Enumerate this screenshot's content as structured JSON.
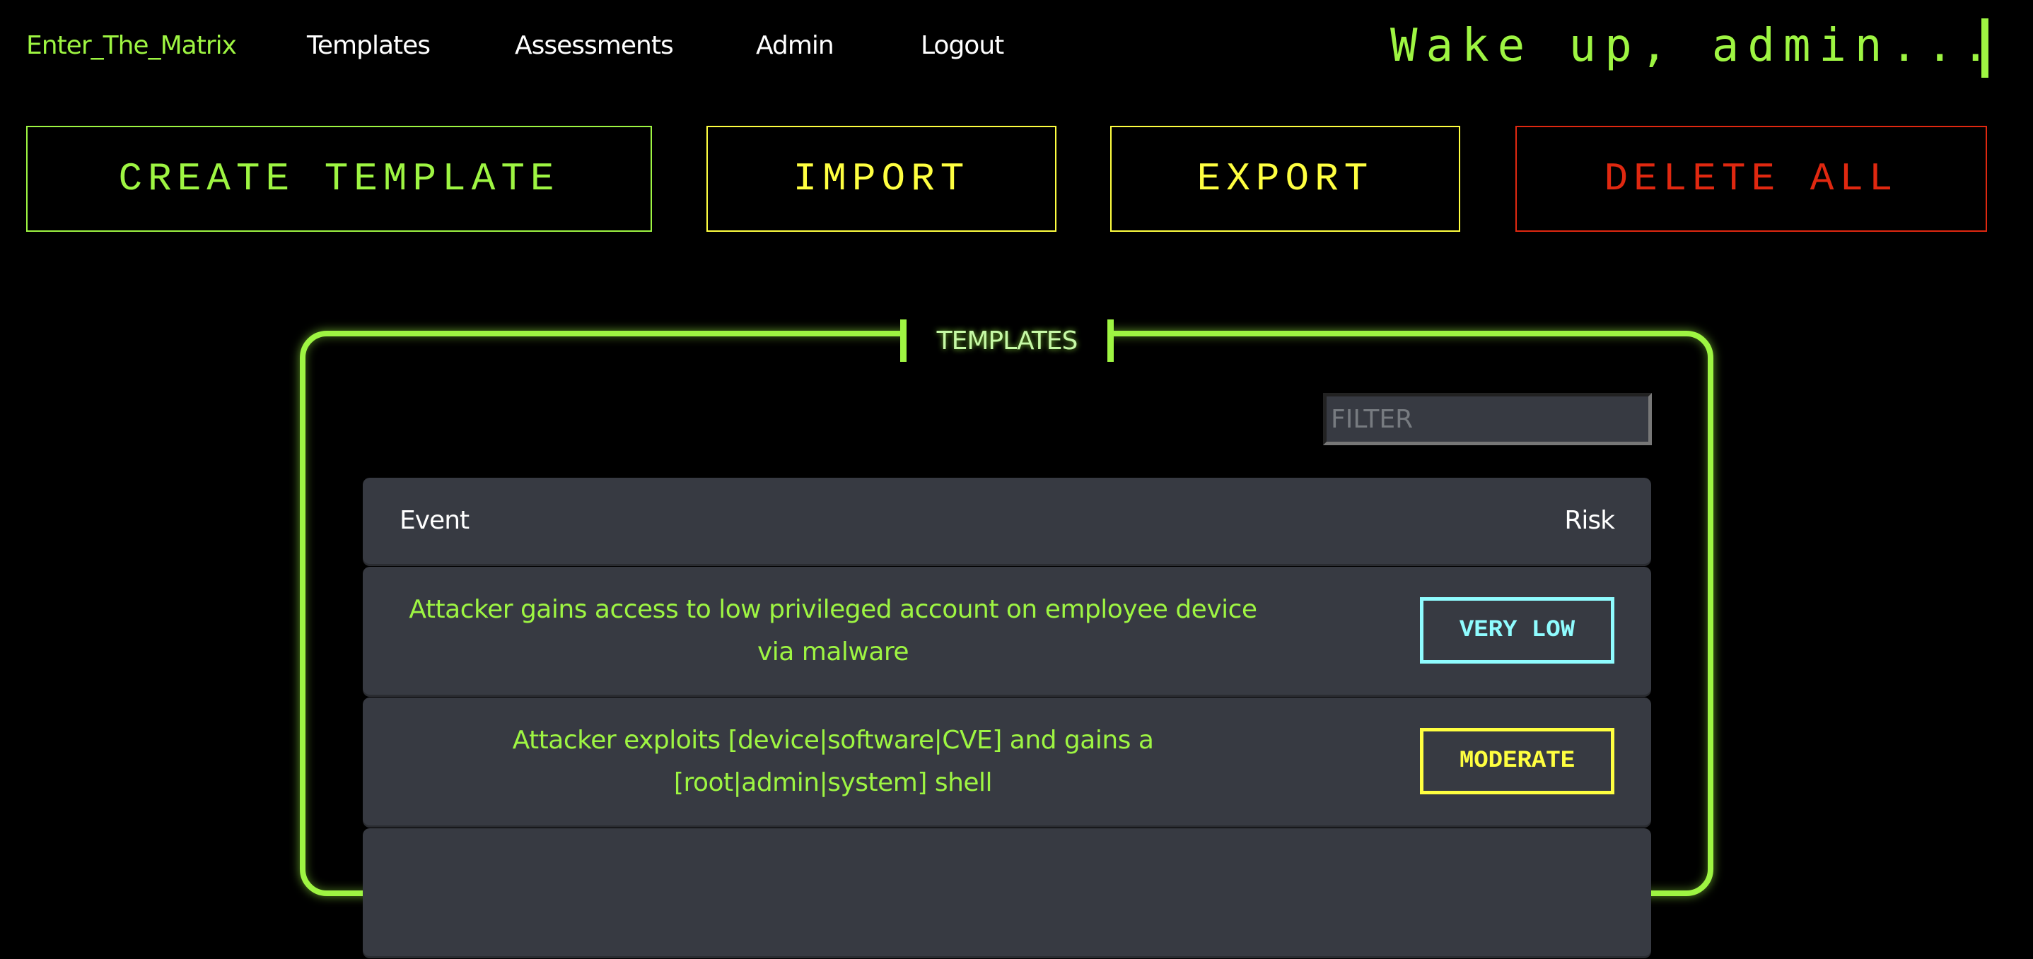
{
  "nav": {
    "brand": "Enter_The_Matrix",
    "items": [
      "Templates",
      "Assessments",
      "Admin",
      "Logout"
    ],
    "greeting": "Wake up, admin..."
  },
  "actions": {
    "create": "CREATE TEMPLATE",
    "import": "IMPORT",
    "export": "EXPORT",
    "delete_all": "DELETE ALL"
  },
  "panel": {
    "title": "TEMPLATES",
    "filter_placeholder": "FILTER",
    "filter_value": "",
    "columns": {
      "event": "Event",
      "risk": "Risk"
    },
    "rows": [
      {
        "event": "Attacker gains access to low privileged account on employee device via malware",
        "risk": "VERY LOW",
        "risk_color": "#8ffcff"
      },
      {
        "event": "Attacker exploits [device|software|CVE] and gains a [root|admin|system] shell",
        "risk": "MODERATE",
        "risk_color": "#ffff40"
      },
      {
        "event": "",
        "risk": "",
        "risk_color": ""
      }
    ]
  },
  "colors": {
    "accent": "#9ef542",
    "warning": "#ffff40",
    "danger": "#e02810",
    "row_bg": "#373a42"
  }
}
